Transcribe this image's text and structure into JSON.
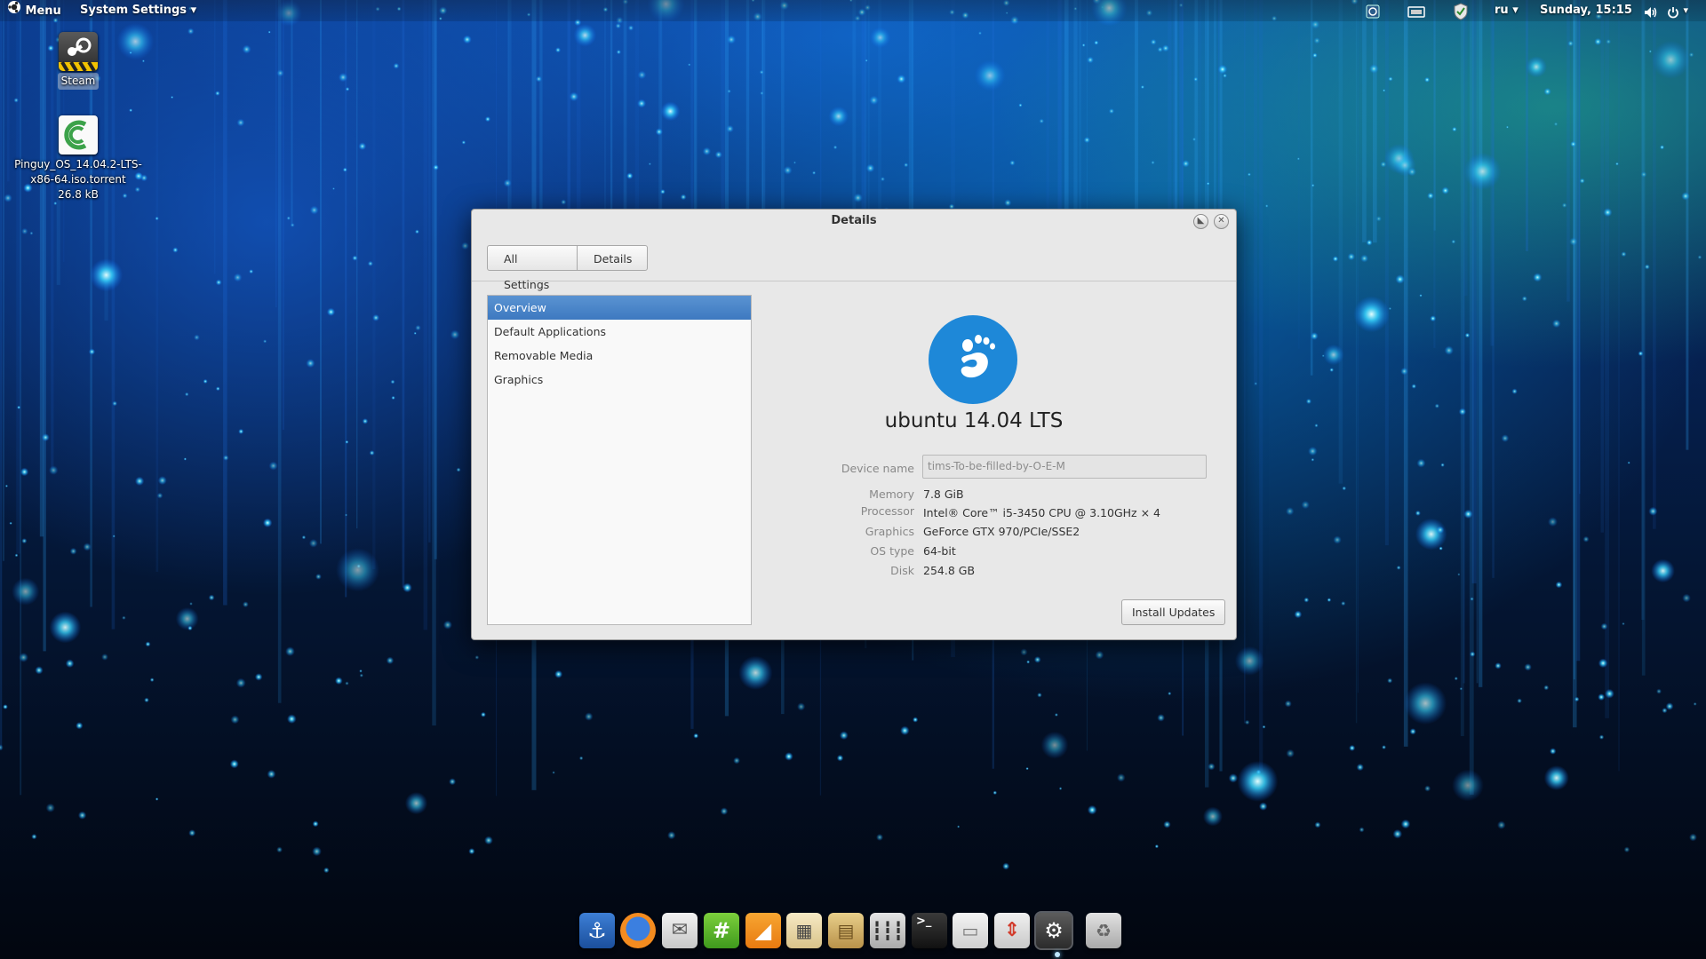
{
  "top_panel": {
    "menu_label": "Menu",
    "app_menu_label": "System Settings ▾",
    "keyboard_layout": "ru ▾",
    "clock": "Sunday, 15:15",
    "icons": [
      "ubuntu-logo-icon",
      "network-icon",
      "display-icon",
      "shield-icon",
      "volume-icon",
      "power-icon"
    ]
  },
  "desktop": {
    "icons": [
      {
        "label": "Steam",
        "icon": "steam-icon"
      },
      {
        "label_lines": [
          "Pinguy_OS_14.04.2-LTS-",
          "x86-64.iso.torrent",
          "26.8 kB"
        ],
        "icon": "torrent-file-icon"
      }
    ]
  },
  "window": {
    "title": "Details",
    "toolbar": {
      "all_settings_label": "All Settings",
      "details_label": "Details"
    },
    "sidebar": {
      "items": [
        {
          "label": "Overview",
          "selected": true
        },
        {
          "label": "Default Applications",
          "selected": false
        },
        {
          "label": "Removable Media",
          "selected": false
        },
        {
          "label": "Graphics",
          "selected": false
        }
      ]
    },
    "overview": {
      "os_name": "ubuntu 14.04 LTS",
      "device_name_label": "Device name",
      "device_name_value": "tims-To-be-filled-by-O-E-M",
      "memory_label": "Memory",
      "memory_value": "7.8 GiB",
      "processor_label": "Processor",
      "processor_value": "Intel® Core™ i5-3450 CPU @ 3.10GHz × 4",
      "graphics_label": "Graphics",
      "graphics_value": "GeForce GTX 970/PCIe/SSE2",
      "os_type_label": "OS type",
      "os_type_value": "64-bit",
      "disk_label": "Disk",
      "disk_value": "254.8 GB",
      "install_updates_label": "Install Updates"
    },
    "colors": {
      "selection": "#3d79c0",
      "logo_blue": "#1e88d8"
    }
  },
  "dock": {
    "items": [
      "anchor-icon",
      "firefox-icon",
      "mail-icon",
      "hexchat-icon",
      "vlc-icon",
      "video-editor-icon",
      "archive-manager-icon",
      "mixer-icon",
      "terminal-icon",
      "files-icon",
      "software-updater-icon",
      "system-settings-icon",
      "trash-icon"
    ]
  }
}
